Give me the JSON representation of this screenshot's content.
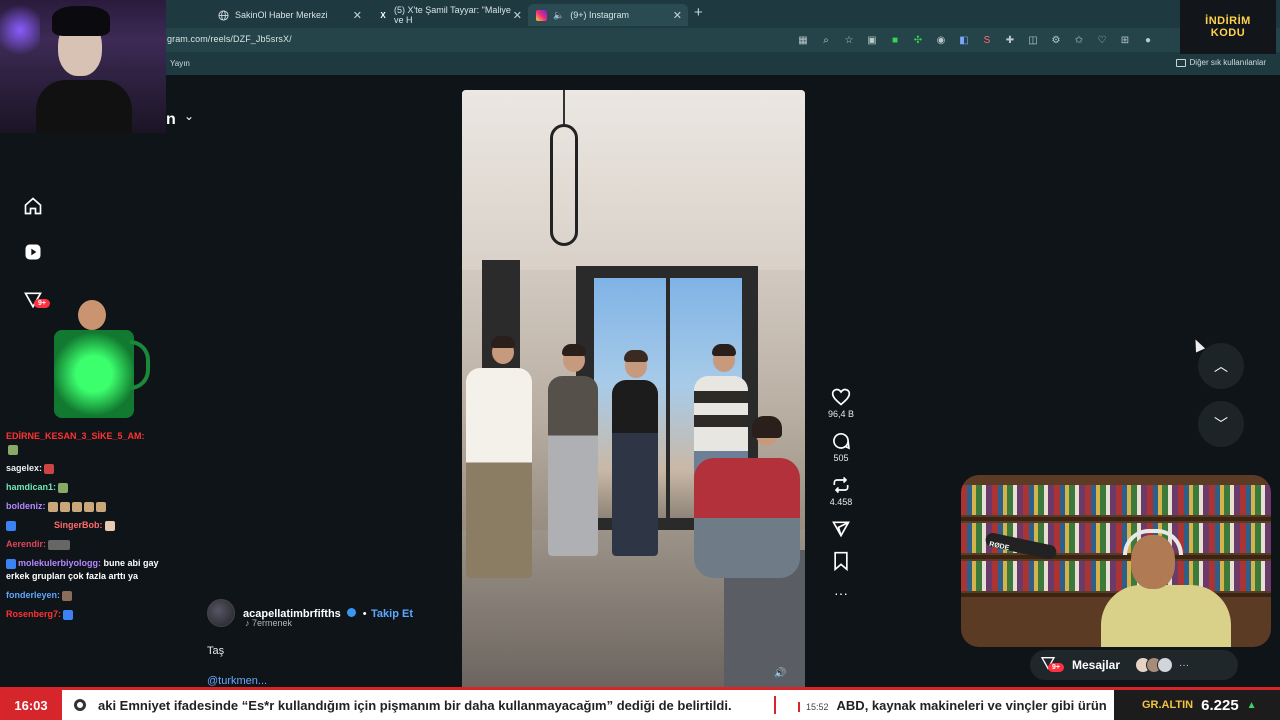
{
  "browser": {
    "tabs": [
      {
        "label": "SakinOl Haber Merkezi",
        "icon": "globe-icon"
      },
      {
        "label": "(5) X'te Şamil Tayyar: \"Maliye ve H",
        "icon": "x-icon"
      },
      {
        "label": "(9+) Instagram",
        "icon": "instagram-icon"
      }
    ],
    "url": "gram.com/reels/DZF_Jb5srsX/",
    "bookmark_left": "Yayın",
    "bookmark_right": "Diğer sık kullanılanlar"
  },
  "sidebar": {
    "account_letter": "n",
    "notif_badge": "9+"
  },
  "reel": {
    "author": "acapellatimbrfifths",
    "follow_label": "Takip Et",
    "audio": "7ermenek",
    "caption": "Taş",
    "mention": "@turkmen...",
    "likes": "96,4 B",
    "comments": "505",
    "reposts": "4.458"
  },
  "messages": {
    "label": "Mesajlar",
    "badge": "9+"
  },
  "stream": {
    "logo_line1": "İNDİRİM",
    "logo_line2": "KODU",
    "mic_brand": "RØDE",
    "chat": [
      {
        "user": "EDİRNE_KESAN_3_SİKE_5_AM:",
        "msg": ""
      },
      {
        "user": "sagelex:",
        "msg": ""
      },
      {
        "user": "hamdican1:",
        "msg": ""
      },
      {
        "user": "boldeniz:",
        "msg": ""
      },
      {
        "user": "SingerBob:",
        "msg": ""
      },
      {
        "user": "Aerendir:",
        "msg": ""
      },
      {
        "user": "molekulerbiyologg:",
        "msg": "bune abi gay erkek grupları çok fazla arttı ya"
      },
      {
        "user": "fonderleyen:",
        "msg": ""
      },
      {
        "user": "Rosenberg7:",
        "msg": ""
      }
    ]
  },
  "ticker": {
    "time": "16:03",
    "headline": "aki Emniyet ifadesinde “Es*r kullandığım için pişmanım bir daha kullanmayacağım” dediği de belirtildi.",
    "second_time": "15:52",
    "second_headline": "ABD, kaynak makineleri ve vinçler gibi ürün",
    "gold_label": "GR.ALTIN",
    "gold_value": "6.225"
  },
  "colors": {
    "accent_red": "#d6262b",
    "link_blue": "#5aa9ff",
    "instagram_badge": "#ff3040",
    "gold": "#f5c242"
  }
}
